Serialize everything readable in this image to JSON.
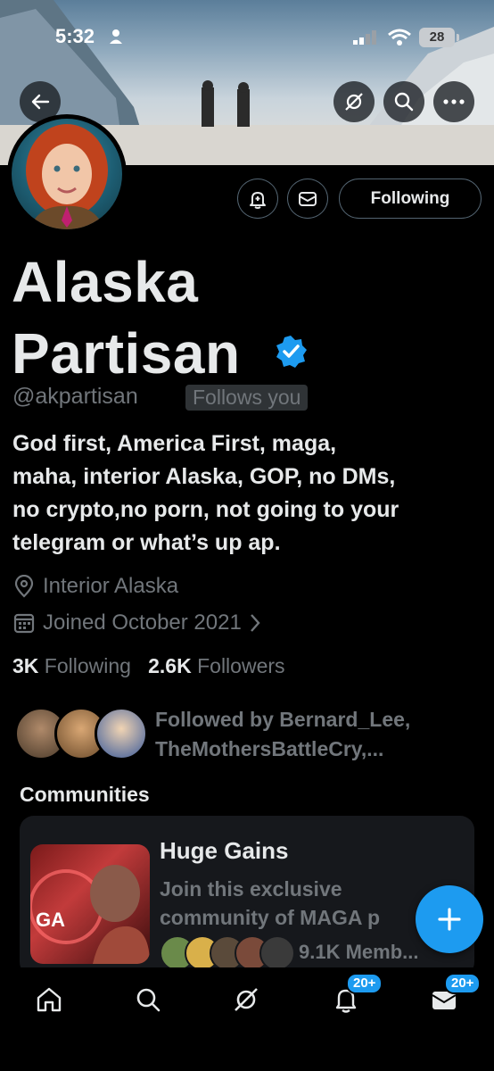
{
  "status_bar": {
    "time": "5:32",
    "battery": "28"
  },
  "profile": {
    "name_line1": "Alaska",
    "name_line2": "Partisan",
    "handle": "@akpartisan",
    "follows_you": "Follows you",
    "bio": [
      "God first, America First, maga,",
      "maha, interior Alaska, GOP, no DMs,",
      "no crypto,no porn, not going to your",
      "telegram or what’s up ap."
    ],
    "location": "Interior Alaska",
    "joined": "Joined October 2021",
    "following_count": "3K",
    "following_label": "Following",
    "followers_count": "2.6K",
    "followers_label": "Followers",
    "followed_by_line1": "Followed by Bernard_Lee,",
    "followed_by_line2": "TheMothersBattleCry,..."
  },
  "actions": {
    "following_button": "Following"
  },
  "communities": {
    "title": "Communities",
    "items": [
      {
        "name": "Huge Gains",
        "desc_line1": "Join this exclusive",
        "desc_line2": "community of MAGA p",
        "members": "9.1K Memb..."
      }
    ]
  },
  "tabbar": {
    "notifications_badge": "20+",
    "messages_badge": "20+"
  },
  "colors": {
    "accent": "#1d9bf0",
    "background": "#000000",
    "muted": "#71767b"
  }
}
